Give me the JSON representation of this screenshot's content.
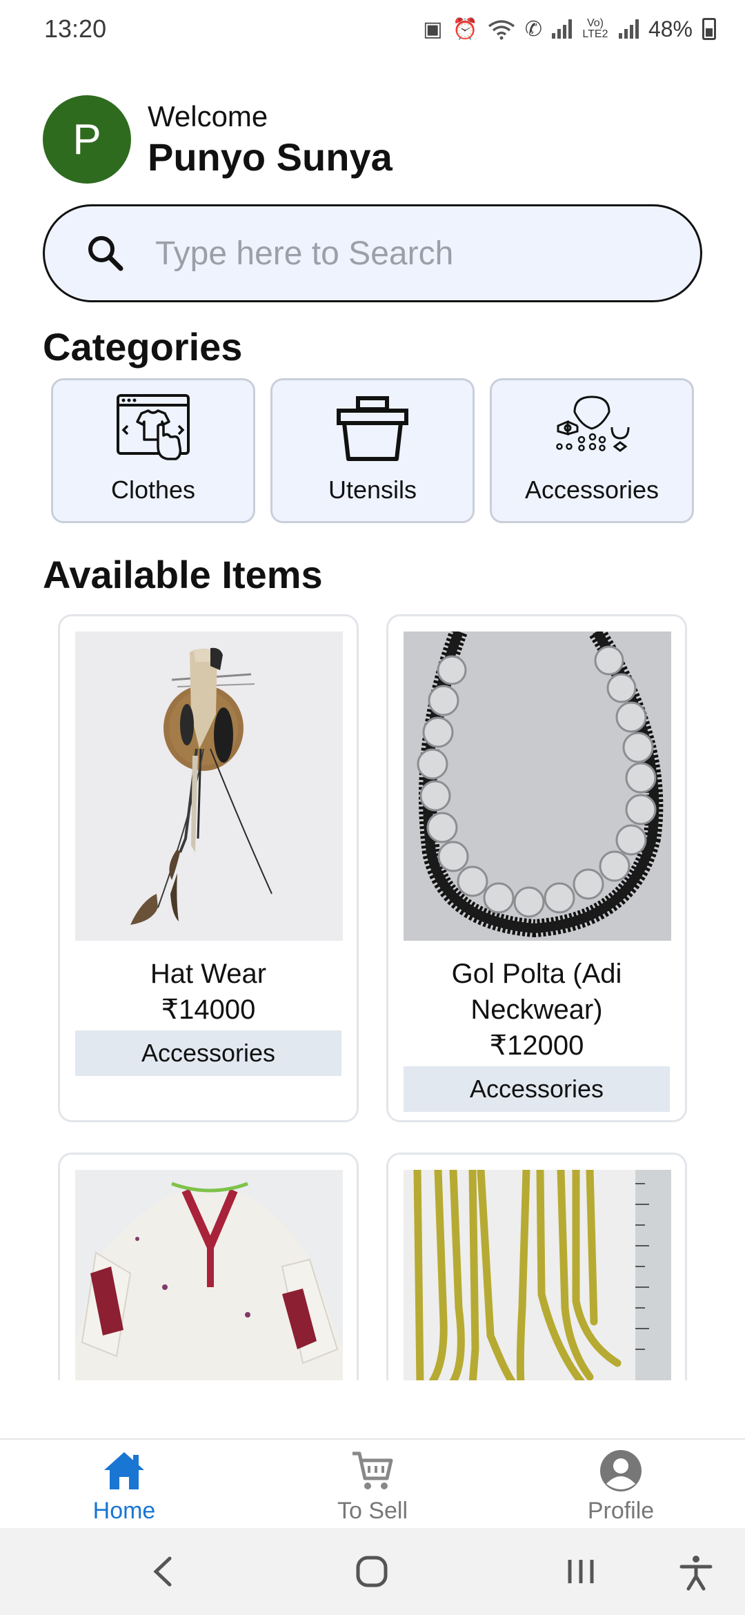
{
  "status_bar": {
    "time": "13:20",
    "network_label": "Vo) LTE2",
    "battery": "48%",
    "icons": [
      "lock-app-icon",
      "alarm-icon",
      "wifi-icon",
      "wifi-call-icon",
      "signal-icon",
      "signal-icon"
    ]
  },
  "header": {
    "avatar_letter": "P",
    "avatar_color": "#2e6b1f",
    "welcome": "Welcome",
    "username": "Punyo Sunya"
  },
  "search": {
    "placeholder": "Type here to Search",
    "value": ""
  },
  "categories": {
    "title": "Categories",
    "items": [
      {
        "label": "Clothes",
        "icon": "clothes-browser-icon"
      },
      {
        "label": "Utensils",
        "icon": "basket-icon"
      },
      {
        "label": "Accessories",
        "icon": "jewelry-icon"
      }
    ]
  },
  "available": {
    "title": "Available Items",
    "products": [
      {
        "name": "Hat Wear",
        "price": "₹14000",
        "category": "Accessories",
        "image": "hat-wear-photo"
      },
      {
        "name": "Gol Polta (Adi Neckwear)",
        "price": "₹12000",
        "category": "Accessories",
        "image": "coin-necklace-photo"
      },
      {
        "name": "",
        "price": "",
        "category": "",
        "image": "white-embroidered-garment-photo"
      },
      {
        "name": "",
        "price": "",
        "category": "",
        "image": "yellow-bead-necklace-photo"
      }
    ]
  },
  "bottom_nav": {
    "items": [
      {
        "label": "Home",
        "icon": "home-icon",
        "active": true
      },
      {
        "label": "To Sell",
        "icon": "cart-icon",
        "active": false
      },
      {
        "label": "Profile",
        "icon": "profile-icon",
        "active": false
      }
    ],
    "active_color": "#1976d2"
  },
  "system_nav": {
    "icons": [
      "back-icon",
      "home-circle-icon",
      "recents-icon",
      "accessibility-icon"
    ]
  }
}
